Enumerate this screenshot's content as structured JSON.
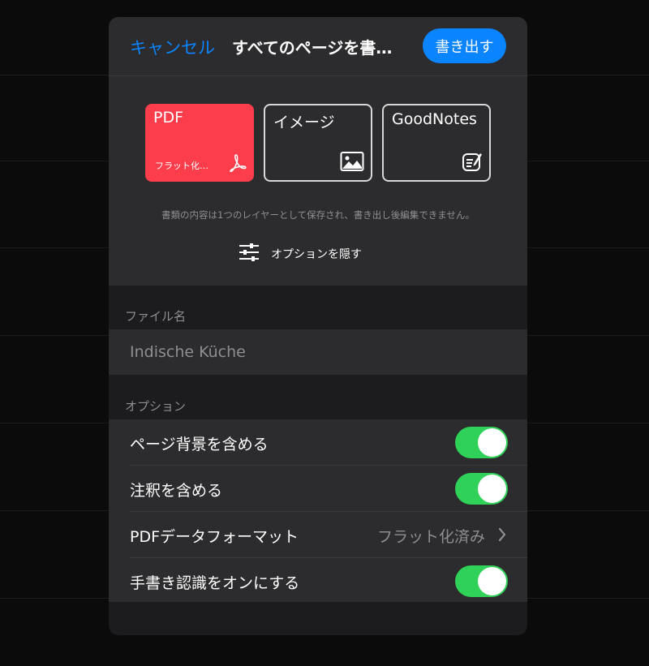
{
  "header": {
    "cancel_label": "キャンセル",
    "title": "すべてのページを書…",
    "export_label": "書き出す"
  },
  "formats": [
    {
      "label": "PDF",
      "sublabel": "フラット化…",
      "icon": "pdf-icon",
      "selected": true
    },
    {
      "label": "イメージ",
      "icon": "image-icon",
      "selected": false
    },
    {
      "label": "GoodNotes",
      "icon": "goodnotes-icon",
      "selected": false
    }
  ],
  "note": "書類の内容は1つのレイヤーとして保存され、書き出し後編集できません。",
  "options_toggle_label": "オプションを隠す",
  "filename": {
    "section_label": "ファイル名",
    "value": "Indische Küche"
  },
  "options": {
    "section_label": "オプション",
    "include_background": {
      "label": "ページ背景を含める",
      "on": true
    },
    "include_annotations": {
      "label": "注釈を含める",
      "on": true
    },
    "pdf_format": {
      "label": "PDFデータフォーマット",
      "value": "フラット化済み"
    },
    "handwriting_recognition": {
      "label": "手書き認識をオンにする",
      "on": true
    }
  },
  "colors": {
    "accent": "#0a84ff",
    "pdf_selected": "#fc3d4b",
    "toggle_on": "#30d158"
  }
}
